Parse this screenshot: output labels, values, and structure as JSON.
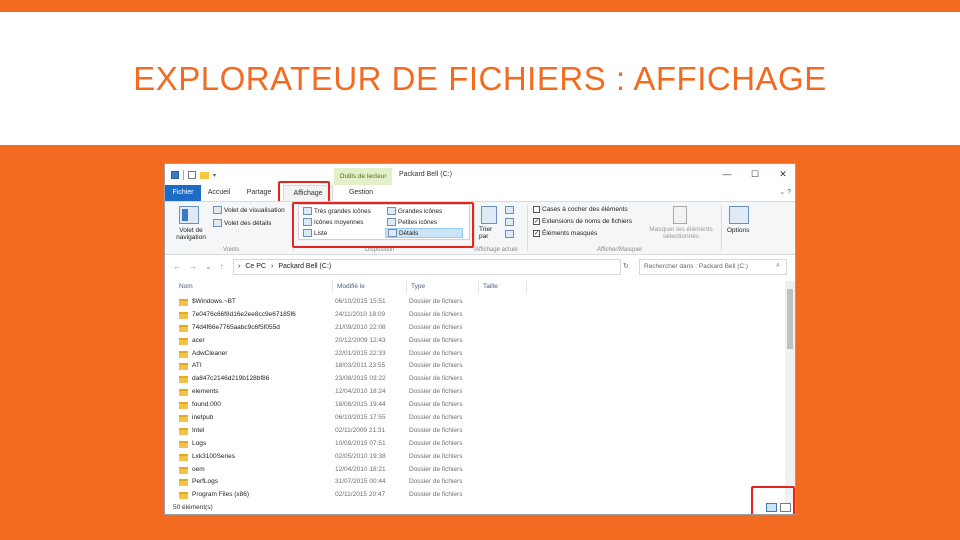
{
  "slide": {
    "title": "EXPLORATEUR DE FICHIERS : AFFICHAGE"
  },
  "window": {
    "context_tab": "Outils de lecteur",
    "title": "Packard Bell (C:)",
    "controls": {
      "minimize": "—",
      "maximize": "☐",
      "close": "✕"
    }
  },
  "tabs": {
    "fichier": "Fichier",
    "accueil": "Accueil",
    "partage": "Partage",
    "affichage": "Affichage",
    "gestion": "Gestion"
  },
  "ribbon": {
    "volet_navigation": "Volet de navigation",
    "volet_visualisation": "Volet de visualisation",
    "volet_details": "Volet des détails",
    "group_volets": "Volets",
    "tres_grandes_icones": "Très grandes icônes",
    "grandes_icones": "Grandes icônes",
    "icones_moyennes": "Icônes moyennes",
    "petites_icones": "Petites icônes",
    "liste": "Liste",
    "details": "Détails",
    "group_disposition": "Disposition",
    "trier_par": "Trier par",
    "group_affichage_actuel": "Affichage actuel",
    "cases_a_cocher": "Cases à cocher des éléments",
    "extensions": "Extensions de noms de fichiers",
    "elements_masques": "Éléments masqués",
    "masquer_elements": "Masquer les éléments sélectionnés",
    "options": "Options",
    "group_afficher_masquer": "Afficher/Masquer"
  },
  "address": {
    "path_root": "Ce PC",
    "path_drive": "Packard Bell (C:)",
    "search_placeholder": "Rechercher dans : Packard Bell (C:)"
  },
  "columns": {
    "nom": "Nom",
    "modifie": "Modifié le",
    "type": "Type",
    "taille": "Taille"
  },
  "files": [
    {
      "name": "$Windows.~BT",
      "date": "06/10/2015 15:51",
      "type": "Dossier de fichiers"
    },
    {
      "name": "7e0476c66f8d16e2ee8cc9e67185f6",
      "date": "24/11/2010 18:09",
      "type": "Dossier de fichiers"
    },
    {
      "name": "74d4f66e7765aabc9c6f5f055d",
      "date": "21/09/2010 22:08",
      "type": "Dossier de fichiers"
    },
    {
      "name": "acer",
      "date": "20/12/2009 12:43",
      "type": "Dossier de fichiers"
    },
    {
      "name": "AdwCleaner",
      "date": "22/01/2015 22:33",
      "type": "Dossier de fichiers"
    },
    {
      "name": "ATI",
      "date": "18/03/2011 23:55",
      "type": "Dossier de fichiers"
    },
    {
      "name": "da847c2146d219b128bf86",
      "date": "23/08/2015 03:22",
      "type": "Dossier de fichiers"
    },
    {
      "name": "elements",
      "date": "12/04/2010 18:24",
      "type": "Dossier de fichiers"
    },
    {
      "name": "found.000",
      "date": "18/08/2015 19:44",
      "type": "Dossier de fichiers"
    },
    {
      "name": "inetpub",
      "date": "06/10/2015 17:55",
      "type": "Dossier de fichiers"
    },
    {
      "name": "Intel",
      "date": "02/11/2009 21:31",
      "type": "Dossier de fichiers"
    },
    {
      "name": "Logs",
      "date": "10/09/2015 07:51",
      "type": "Dossier de fichiers"
    },
    {
      "name": "Lxk3100Series",
      "date": "02/05/2010 19:38",
      "type": "Dossier de fichiers"
    },
    {
      "name": "oem",
      "date": "12/04/2010 18:21",
      "type": "Dossier de fichiers"
    },
    {
      "name": "PerfLogs",
      "date": "31/07/2015 00:44",
      "type": "Dossier de fichiers"
    },
    {
      "name": "Program Files (x86)",
      "date": "02/11/2015 20:47",
      "type": "Dossier de fichiers"
    }
  ],
  "status": {
    "count": "50 élément(s)"
  }
}
